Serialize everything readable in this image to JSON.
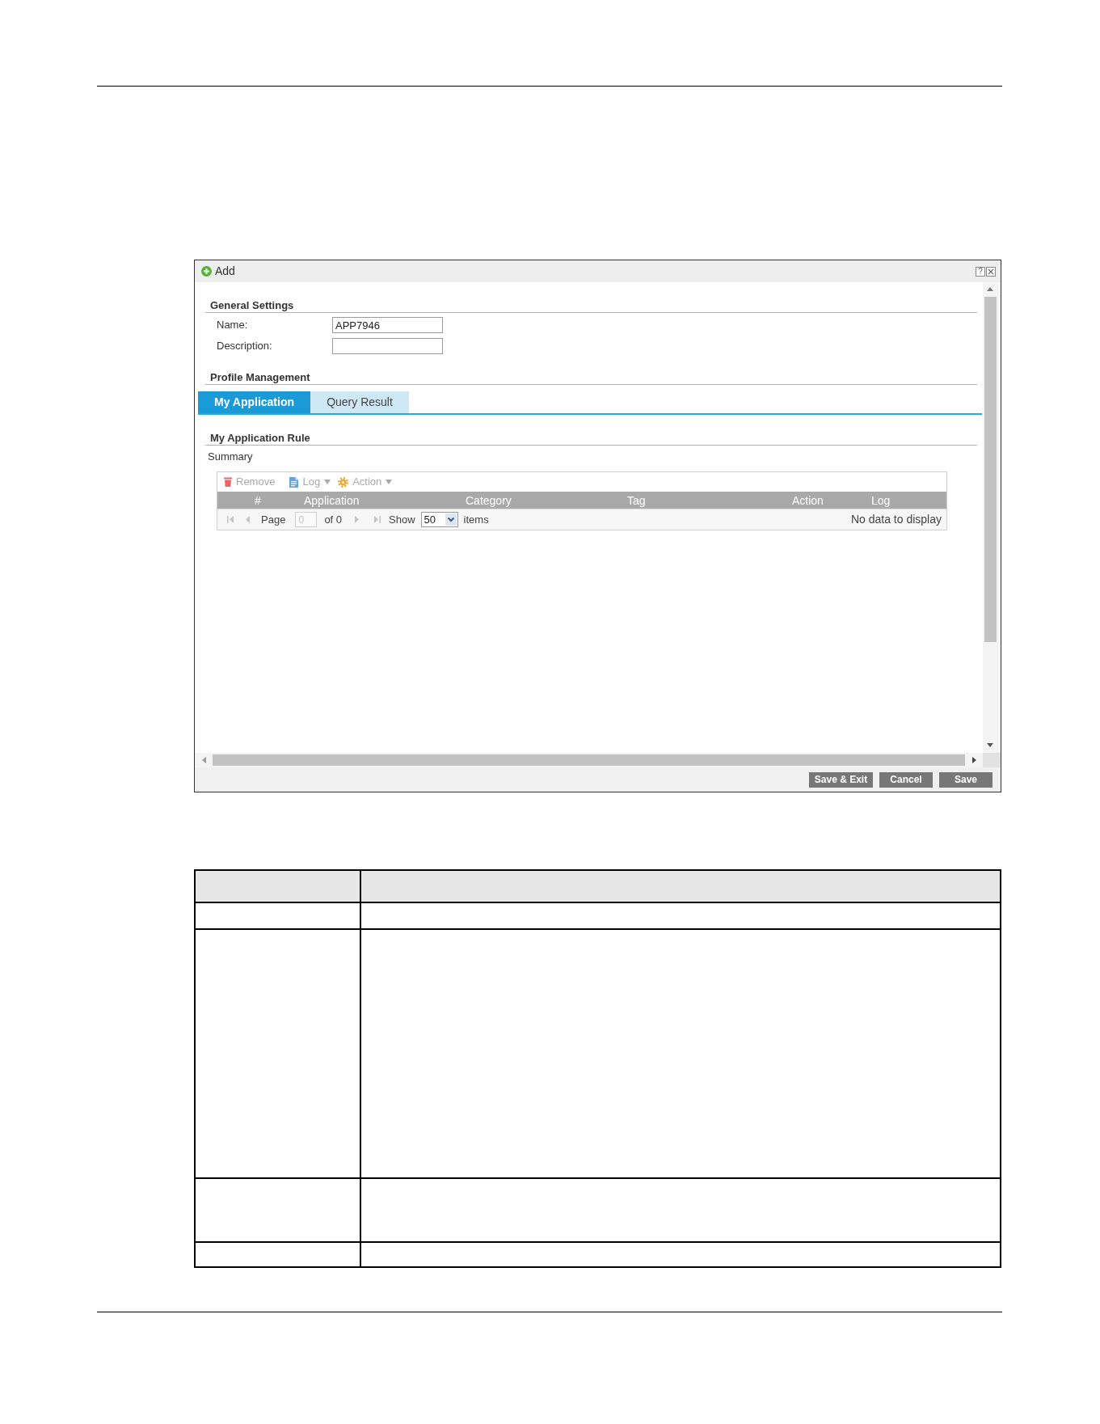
{
  "dialog": {
    "title": "Add",
    "help_label": "?"
  },
  "general_settings": {
    "heading": "General Settings",
    "fields": [
      {
        "label": "Name:",
        "value": "APP7946"
      },
      {
        "label": "Description:"
      }
    ]
  },
  "profile_management": {
    "heading": "Profile Management",
    "tabs": [
      {
        "label": "My Application",
        "selected": true
      },
      {
        "label": "Query Result",
        "selected": false
      }
    ]
  },
  "rule_section": {
    "heading": "My Application Rule",
    "summary": "Summary",
    "toolbar": [
      {
        "label": "Remove",
        "kind": "button",
        "disabled": true
      },
      {
        "label": "Log",
        "kind": "dropdown",
        "disabled": true
      },
      {
        "label": "Action",
        "kind": "dropdown",
        "disabled": true
      }
    ],
    "columns": [
      "#",
      "Application",
      "Category",
      "Tag",
      "Action",
      "Log"
    ],
    "pager": {
      "page_label": "Page",
      "page_value": "0",
      "of_label": "of 0",
      "show_label": "Show",
      "page_size": "50",
      "items_label": "items",
      "status": "No data to display",
      "disabled": true
    }
  },
  "footer_buttons": [
    "Save & Exit",
    "Cancel",
    "Save"
  ]
}
